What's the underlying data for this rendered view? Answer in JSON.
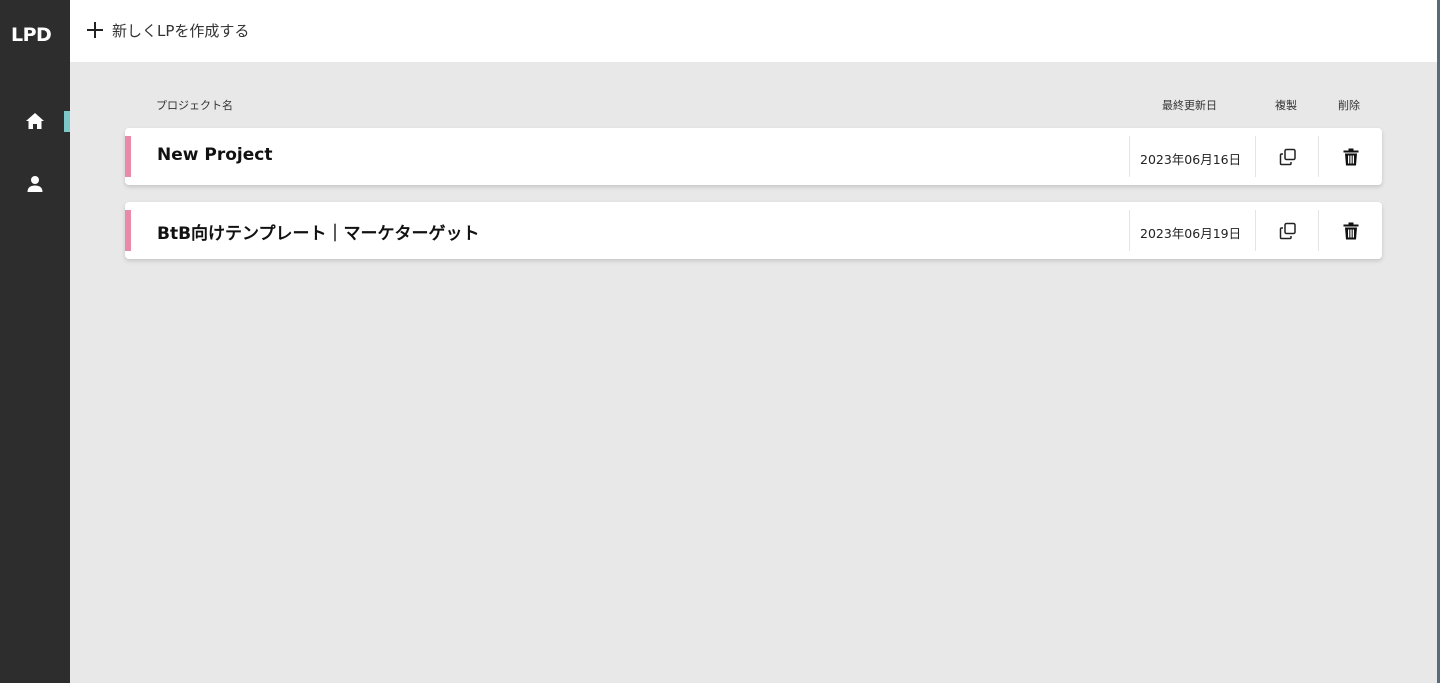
{
  "app": {
    "logo": "LPD"
  },
  "sidebar": {
    "items": [
      {
        "icon": "home-icon",
        "active": true
      },
      {
        "icon": "user-icon",
        "active": false
      }
    ],
    "active_color": "#7cc8c8"
  },
  "topbar": {
    "create_label": "新しくLPを作成する"
  },
  "table": {
    "headers": {
      "name": "プロジェクト名",
      "updated": "最終更新日",
      "copy": "複製",
      "delete": "削除"
    },
    "rows": [
      {
        "name": "New Project",
        "updated": "2023年06月16日"
      },
      {
        "name": "BtB向けテンプレート｜マーケターゲット",
        "updated": "2023年06月19日"
      }
    ]
  },
  "colors": {
    "accent_pink": "#e98aa8",
    "sidebar_bg": "#2d2d2d",
    "main_bg": "#e8e8e8"
  }
}
